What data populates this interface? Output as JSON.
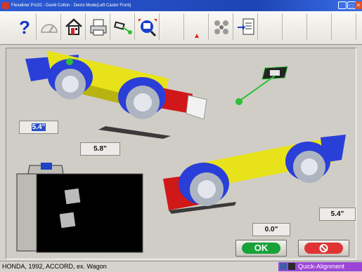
{
  "window": {
    "title": "Flexaliner Pro32 - David Colton - Demo Mode(Left Caster Front)"
  },
  "readouts": {
    "left_top": "5.4\"",
    "left_bottom": "5.8\"",
    "right_top": "5.4\"",
    "right_bottom": "0.0\""
  },
  "buttons": {
    "ok": "OK"
  },
  "status": {
    "vehicle": "HONDA, 1992, ACCORD, ex. Wagon",
    "mode": "Quick-Alignment"
  },
  "colors": {
    "titlebar": "#1d44b4",
    "car_body_yellow": "#e8e21a",
    "car_body_blue": "#2a3fd8",
    "car_bumper_red": "#d01818",
    "target_green": "#2fbf3a",
    "ok_green": "#18a23a",
    "cancel_red": "#e03434",
    "status_purple": "#9b45d6"
  },
  "icons": [
    "help-icon",
    "gauge-icon",
    "home-icon",
    "printer-icon",
    "target-measure-icon",
    "zoom-target-icon",
    "warning-icon",
    "wheel-setup-icon",
    "document-export-icon"
  ]
}
